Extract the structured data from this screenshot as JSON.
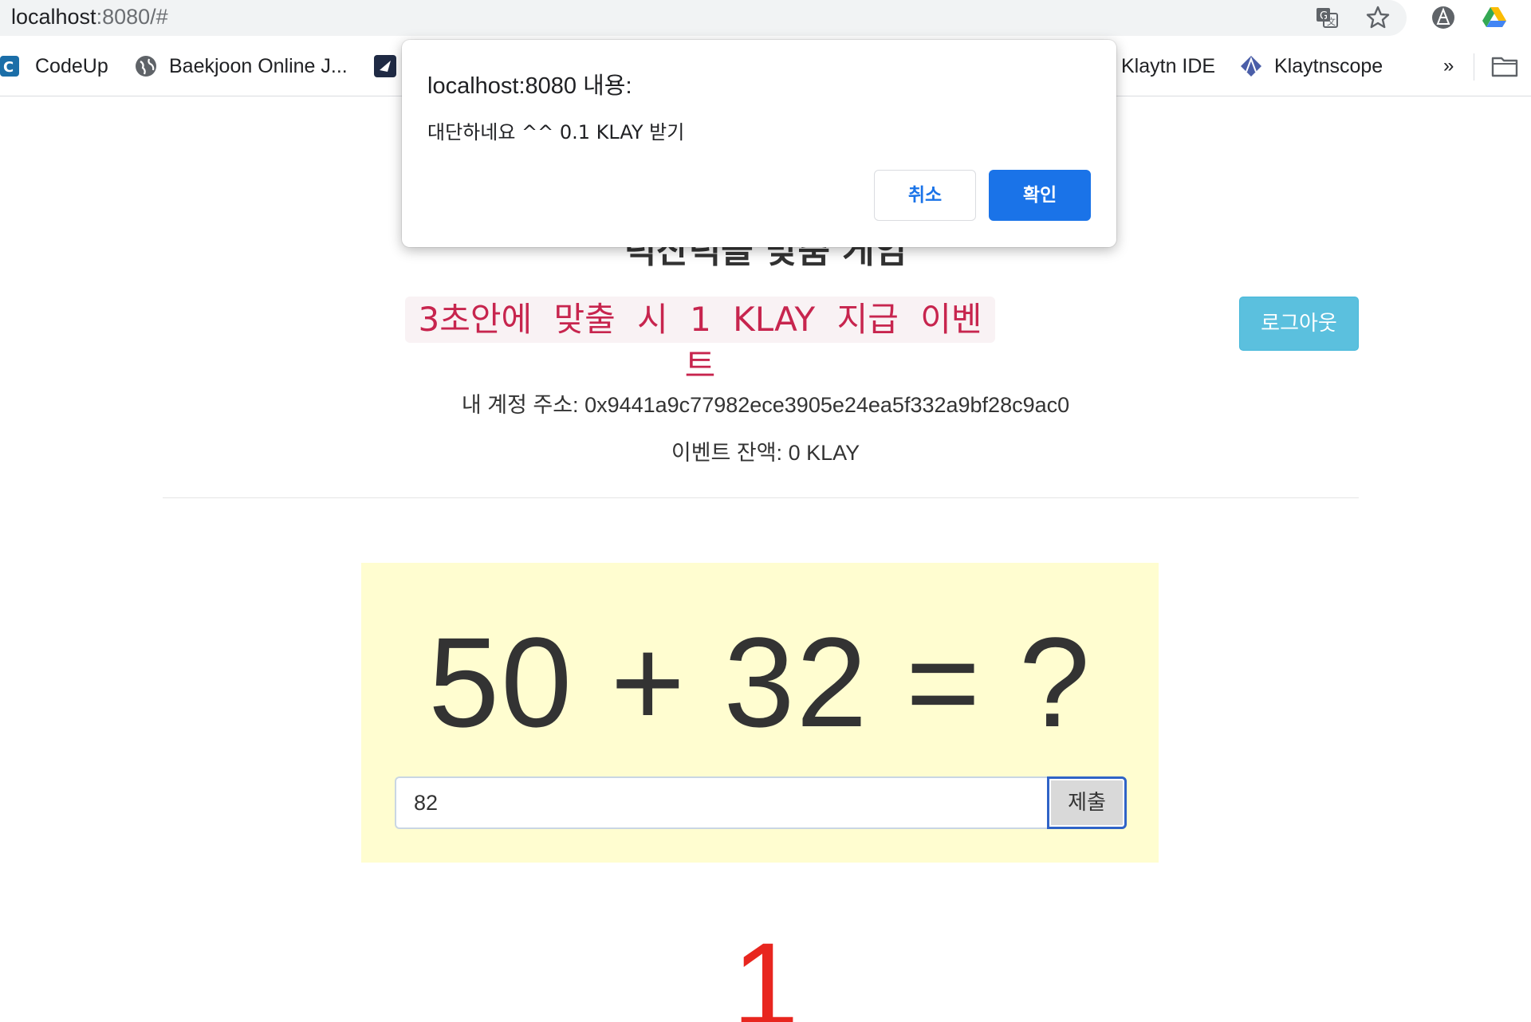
{
  "browser": {
    "url_host": "localhost",
    "url_rest": ":8080/#",
    "icons": [
      "translate-icon",
      "star-icon",
      "extension-icon",
      "google-drive-icon"
    ]
  },
  "bookmarks": [
    {
      "label": "CodeUp",
      "icon": "codeup-favicon"
    },
    {
      "label": "Baekjoon Online J...",
      "icon": "globe-favicon"
    },
    {
      "label": "",
      "icon": "bookmark-favicon"
    },
    {
      "label": "Klaytn IDE",
      "icon": ""
    },
    {
      "label": "Klaytnscope",
      "icon": "klaytn-favicon"
    }
  ],
  "bookmarks_more": "»",
  "page": {
    "title": "덕산덕을 맞춤 게임",
    "event_label": "3초안에 맞출 시 1 KLAY 지급 이벤트",
    "logout_label": "로그아웃",
    "address": "내 계정 주소: 0x9441a9c77982ece3905e24ea5f332a9bf28c9ac0",
    "balance": "이벤트 잔액: 0 KLAY",
    "question": "50 + 32 = ?",
    "answer_value": "82",
    "submit_label": "제출",
    "timer": "1"
  },
  "dialog": {
    "title": "localhost:8080 내용:",
    "message": "대단하네요 ^^ 0.1 KLAY 받기",
    "cancel_label": "취소",
    "ok_label": "확인"
  },
  "colors": {
    "event_text": "#c7254e",
    "event_bg": "#f9f2f4",
    "logout_bg": "#5bc0de",
    "quiz_bg": "#fffdd0",
    "timer": "#e8261f",
    "dialog_ok": "#1a73e8"
  }
}
